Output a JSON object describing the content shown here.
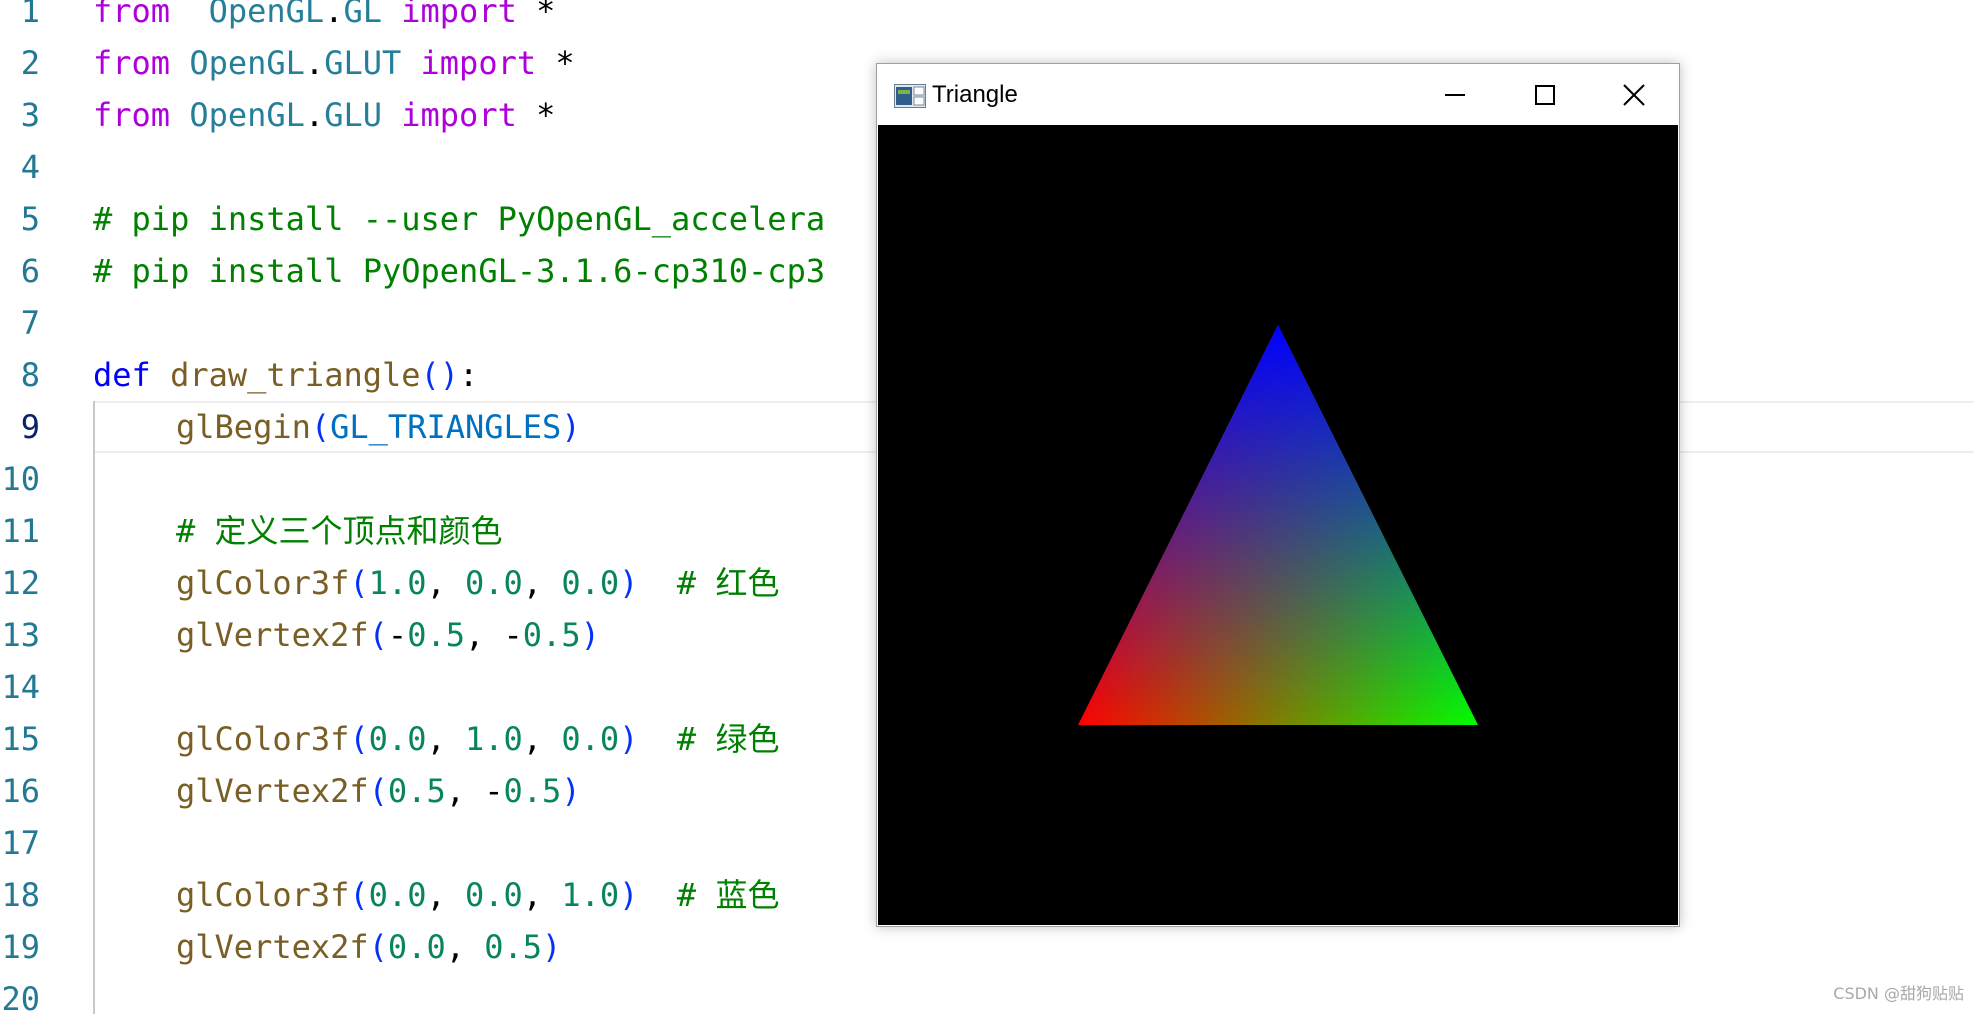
{
  "editor": {
    "active_line": "9",
    "lines": [
      {
        "n": "1",
        "parts": [
          [
            "kw",
            "from"
          ],
          [
            "",
            "  "
          ],
          [
            "mod",
            "OpenGL"
          ],
          [
            "",
            "."
          ],
          [
            "mod",
            "GL"
          ],
          [
            "",
            " "
          ],
          [
            "kw",
            "import"
          ],
          [
            "",
            " *"
          ]
        ]
      },
      {
        "n": "2",
        "parts": [
          [
            "kw",
            "from"
          ],
          [
            "",
            " "
          ],
          [
            "mod",
            "OpenGL"
          ],
          [
            "",
            "."
          ],
          [
            "mod",
            "GLUT"
          ],
          [
            "",
            " "
          ],
          [
            "kw",
            "import"
          ],
          [
            "",
            " *"
          ]
        ]
      },
      {
        "n": "3",
        "parts": [
          [
            "kw",
            "from"
          ],
          [
            "",
            " "
          ],
          [
            "mod",
            "OpenGL"
          ],
          [
            "",
            "."
          ],
          [
            "mod",
            "GLU"
          ],
          [
            "",
            " "
          ],
          [
            "kw",
            "import"
          ],
          [
            "",
            " *"
          ]
        ]
      },
      {
        "n": "4",
        "parts": []
      },
      {
        "n": "5",
        "parts": [
          [
            "cmt",
            "# pip install --user PyOpenGL_accelera"
          ]
        ]
      },
      {
        "n": "6",
        "parts": [
          [
            "cmt",
            "# pip install PyOpenGL-3.1.6-cp310-cp3"
          ]
        ]
      },
      {
        "n": "7",
        "parts": []
      },
      {
        "n": "8",
        "parts": [
          [
            "kw2",
            "def"
          ],
          [
            "",
            " "
          ],
          [
            "fn",
            "draw_triangle"
          ],
          [
            "br",
            "()"
          ],
          [
            "",
            ":"
          ]
        ]
      },
      {
        "n": "9",
        "indent": true,
        "parts": [
          [
            "fn",
            "glBegin"
          ],
          [
            "br",
            "("
          ],
          [
            "cst",
            "GL_TRIANGLES"
          ],
          [
            "br",
            ")"
          ]
        ]
      },
      {
        "n": "10",
        "parts": []
      },
      {
        "n": "11",
        "indent": true,
        "parts": [
          [
            "cmt",
            "# "
          ],
          [
            "cmt cn",
            "定义三个顶点和颜色"
          ]
        ]
      },
      {
        "n": "12",
        "indent": true,
        "parts": [
          [
            "fn",
            "glColor3f"
          ],
          [
            "br",
            "("
          ],
          [
            "num",
            "1.0"
          ],
          [
            "",
            ", "
          ],
          [
            "num",
            "0.0"
          ],
          [
            "",
            ", "
          ],
          [
            "num",
            "0.0"
          ],
          [
            "br",
            ")"
          ],
          [
            "",
            "  "
          ],
          [
            "cmt",
            "# "
          ],
          [
            "cmt cn",
            "红色"
          ]
        ]
      },
      {
        "n": "13",
        "indent": true,
        "parts": [
          [
            "fn",
            "glVertex2f"
          ],
          [
            "br",
            "("
          ],
          [
            "",
            "-"
          ],
          [
            "num",
            "0.5"
          ],
          [
            "",
            ", -"
          ],
          [
            "num",
            "0.5"
          ],
          [
            "br",
            ")"
          ]
        ]
      },
      {
        "n": "14",
        "parts": []
      },
      {
        "n": "15",
        "indent": true,
        "parts": [
          [
            "fn",
            "glColor3f"
          ],
          [
            "br",
            "("
          ],
          [
            "num",
            "0.0"
          ],
          [
            "",
            ", "
          ],
          [
            "num",
            "1.0"
          ],
          [
            "",
            ", "
          ],
          [
            "num",
            "0.0"
          ],
          [
            "br",
            ")"
          ],
          [
            "",
            "  "
          ],
          [
            "cmt",
            "# "
          ],
          [
            "cmt cn",
            "绿色"
          ]
        ]
      },
      {
        "n": "16",
        "indent": true,
        "parts": [
          [
            "fn",
            "glVertex2f"
          ],
          [
            "br",
            "("
          ],
          [
            "num",
            "0.5"
          ],
          [
            "",
            ", -"
          ],
          [
            "num",
            "0.5"
          ],
          [
            "br",
            ")"
          ]
        ]
      },
      {
        "n": "17",
        "parts": []
      },
      {
        "n": "18",
        "indent": true,
        "parts": [
          [
            "fn",
            "glColor3f"
          ],
          [
            "br",
            "("
          ],
          [
            "num",
            "0.0"
          ],
          [
            "",
            ", "
          ],
          [
            "num",
            "0.0"
          ],
          [
            "",
            ", "
          ],
          [
            "num",
            "1.0"
          ],
          [
            "br",
            ")"
          ],
          [
            "",
            "  "
          ],
          [
            "cmt",
            "# "
          ],
          [
            "cmt cn",
            "蓝色"
          ]
        ]
      },
      {
        "n": "19",
        "indent": true,
        "parts": [
          [
            "fn",
            "glVertex2f"
          ],
          [
            "br",
            "("
          ],
          [
            "num",
            "0.0"
          ],
          [
            "",
            ", "
          ],
          [
            "num",
            "0.5"
          ],
          [
            "br",
            ")"
          ]
        ]
      },
      {
        "n": "20",
        "parts": []
      }
    ]
  },
  "window": {
    "title": "Triangle",
    "icon": "app-window-icon",
    "buttons": {
      "minimize": "minimize-icon",
      "maximize": "maximize-icon",
      "close": "close-icon"
    },
    "canvas_background": "#000000",
    "triangle": {
      "vertex_colors": {
        "bottom_left": "#ff0000",
        "bottom_right": "#00ff00",
        "top": "#0000ff"
      }
    }
  },
  "watermark": "CSDN @甜狗贴贴"
}
